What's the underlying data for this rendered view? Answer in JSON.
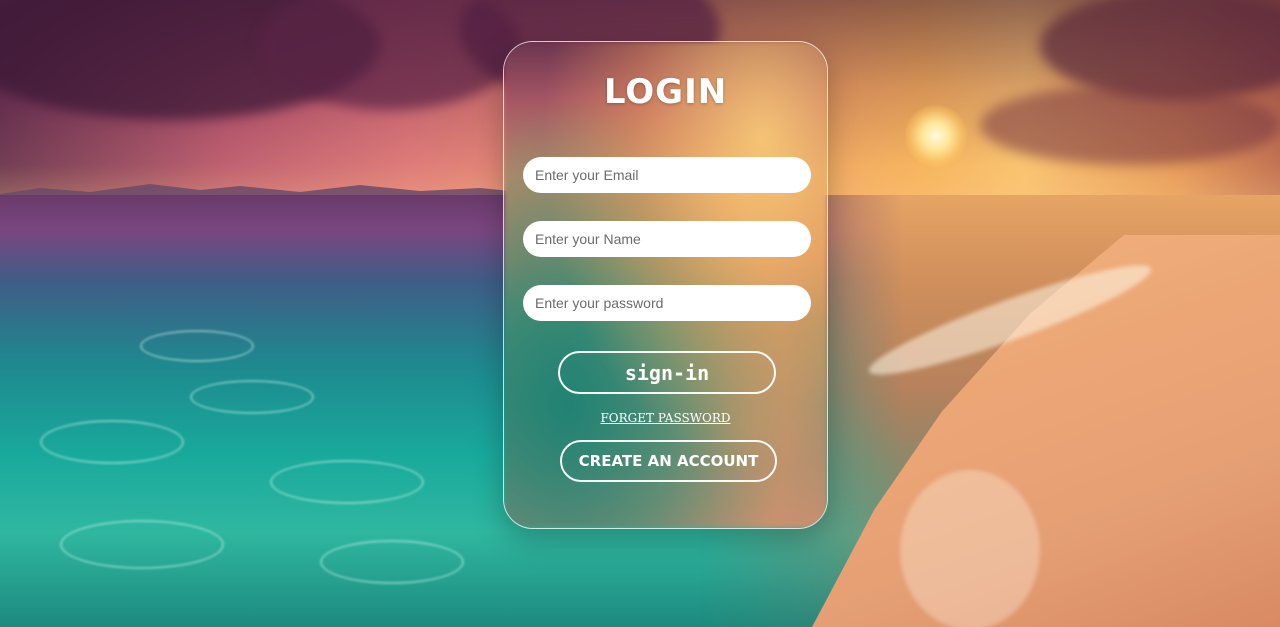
{
  "login": {
    "title": "LOGIN",
    "email_placeholder": "Enter your Email",
    "name_placeholder": "Enter your Name",
    "password_placeholder": "Enter your password",
    "signin_label": "sign-in",
    "forget_label": "FORGET PASSWORD",
    "create_label": "CREATE AN ACCOUNT"
  }
}
